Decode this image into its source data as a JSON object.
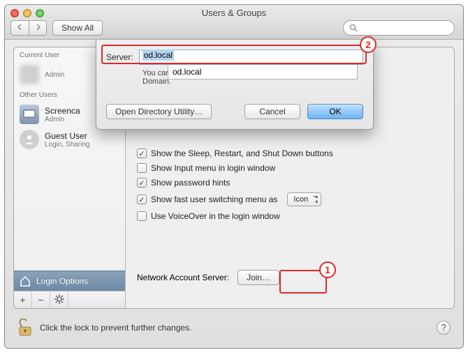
{
  "window": {
    "title": "Users & Groups",
    "show_all": "Show All",
    "search_placeholder": ""
  },
  "sidebar": {
    "current_header": "Current User",
    "other_header": "Other Users",
    "current": {
      "name": "",
      "role": "Admin"
    },
    "others": [
      {
        "name": "Screenca",
        "role": "Admin"
      },
      {
        "name": "Guest User",
        "role": "Login, Sharing"
      }
    ],
    "login_options": "Login Options"
  },
  "main": {
    "options": [
      {
        "label": "Show the Sleep, Restart, and Shut Down buttons",
        "checked": true
      },
      {
        "label": "Show Input menu in login window",
        "checked": false
      },
      {
        "label": "Show password hints",
        "checked": true
      },
      {
        "label": "Show fast user switching menu as",
        "checked": true,
        "select": "Icon"
      },
      {
        "label": "Use VoiceOver in the login window",
        "checked": false
      }
    ],
    "nas_label": "Network Account Server:",
    "join_label": "Join…"
  },
  "sheet": {
    "server_label": "Server:",
    "server_value": "od.local",
    "autocomplete": "od.local",
    "hint_prefix": "You can e",
    "hint_suffix": "Domain.",
    "open_dir": "Open Directory Utility…",
    "cancel": "Cancel",
    "ok": "OK"
  },
  "lock_text": "Click the lock to prevent further changes.",
  "annotations": {
    "one": "1",
    "two": "2"
  }
}
